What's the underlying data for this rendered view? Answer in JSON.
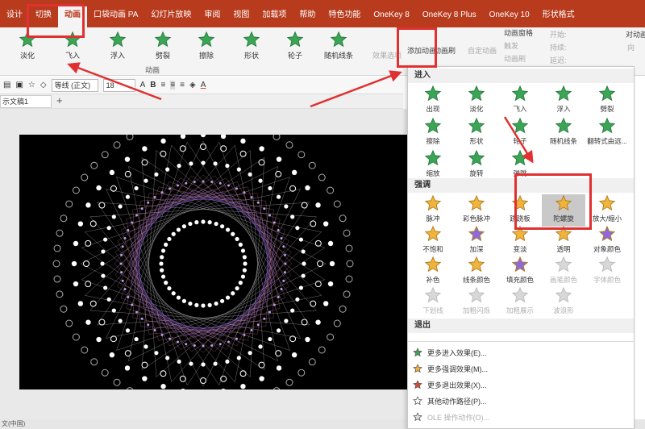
{
  "ribbon_tabs": [
    "设计",
    "切换",
    "动画",
    "口袋动画 PA",
    "幻灯片放映",
    "审阅",
    "视图",
    "加载项",
    "帮助",
    "特色功能",
    "OneKey 8",
    "OneKey 8 Plus",
    "OneKey 10",
    "形状格式"
  ],
  "active_tab": "动画",
  "ribbon_animations": [
    "淡化",
    "飞入",
    "浮入",
    "劈裂",
    "擦除",
    "形状",
    "轮子",
    "随机线条"
  ],
  "group_label": "动画",
  "effect_options": "效果选项",
  "add_animation": "添加动画",
  "anim_painter": "动画刷",
  "custom_anim": "自定动画",
  "anim_pane": "动画窗格",
  "trigger": "触发",
  "anim_brush": "动画刷",
  "start_label": "开始:",
  "duration_label": "持续:",
  "delay_label": "延迟:",
  "reorder_label": "对动画",
  "move_earlier": "向",
  "format_bar": {
    "font": "等线 (正文)",
    "size": "18",
    "bold": "B",
    "font_grow": "A",
    "font_color": "A"
  },
  "doc_tab": "示文稿1",
  "new_tab": "+",
  "status": "文(中国)",
  "sections": {
    "entrance": "进入",
    "emphasis": "强调",
    "exit": "退出"
  },
  "entrance_effects": [
    "出现",
    "淡化",
    "飞入",
    "浮入",
    "劈裂",
    "擦除",
    "形状",
    "轮子",
    "随机线条",
    "翻转式由远...",
    "缩放",
    "旋转",
    "弹跳"
  ],
  "emphasis_effects": [
    "脉冲",
    "彩色脉冲",
    "跷跷板",
    "陀螺旋",
    "放大/缩小",
    "不饱和",
    "加深",
    "变淡",
    "透明",
    "对象颜色",
    "补色",
    "线条颜色",
    "填充颜色",
    "画笔颜色",
    "字体颜色",
    "下划线",
    "加粗闪烁",
    "加粗展示",
    "波浪形"
  ],
  "menu_items": [
    "更多进入效果(E)...",
    "更多强调效果(M)...",
    "更多退出效果(X)...",
    "其他动作路径(P)...",
    "OLE 操作动作(O)..."
  ],
  "colors": {
    "accent": "#b83b1e",
    "star_green": "#3aa655",
    "star_gold": "#f0b43c",
    "star_red": "#d9483b",
    "annotation_red": "#e03030"
  }
}
